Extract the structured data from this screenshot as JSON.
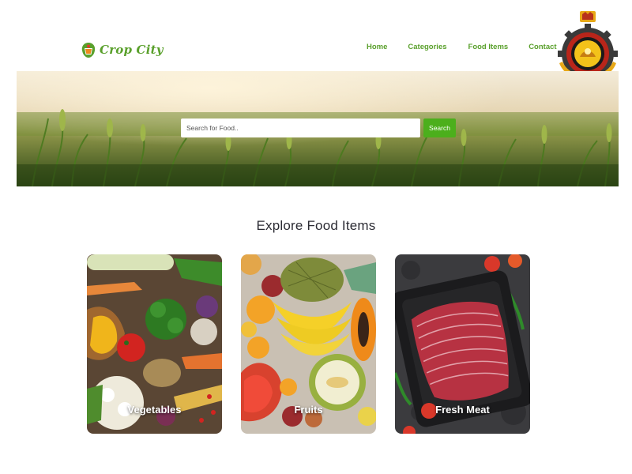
{
  "brand": {
    "name": "Crop City",
    "color": "#5aa02c"
  },
  "nav": {
    "items": [
      {
        "label": "Home"
      },
      {
        "label": "Categories"
      },
      {
        "label": "Food Items"
      },
      {
        "label": "Contact"
      }
    ]
  },
  "search": {
    "placeholder": "Search for Food..",
    "value": "",
    "button_label": "Search",
    "button_color": "#4caf1c"
  },
  "section": {
    "title": "Explore Food Items"
  },
  "categories": [
    {
      "label": "Vegetables"
    },
    {
      "label": "Fruits"
    },
    {
      "label": "Fresh Meat"
    }
  ],
  "icons": {
    "logo": "produce-basket-icon",
    "emblem": "university-emblem",
    "hero": "wheat-field-image"
  }
}
